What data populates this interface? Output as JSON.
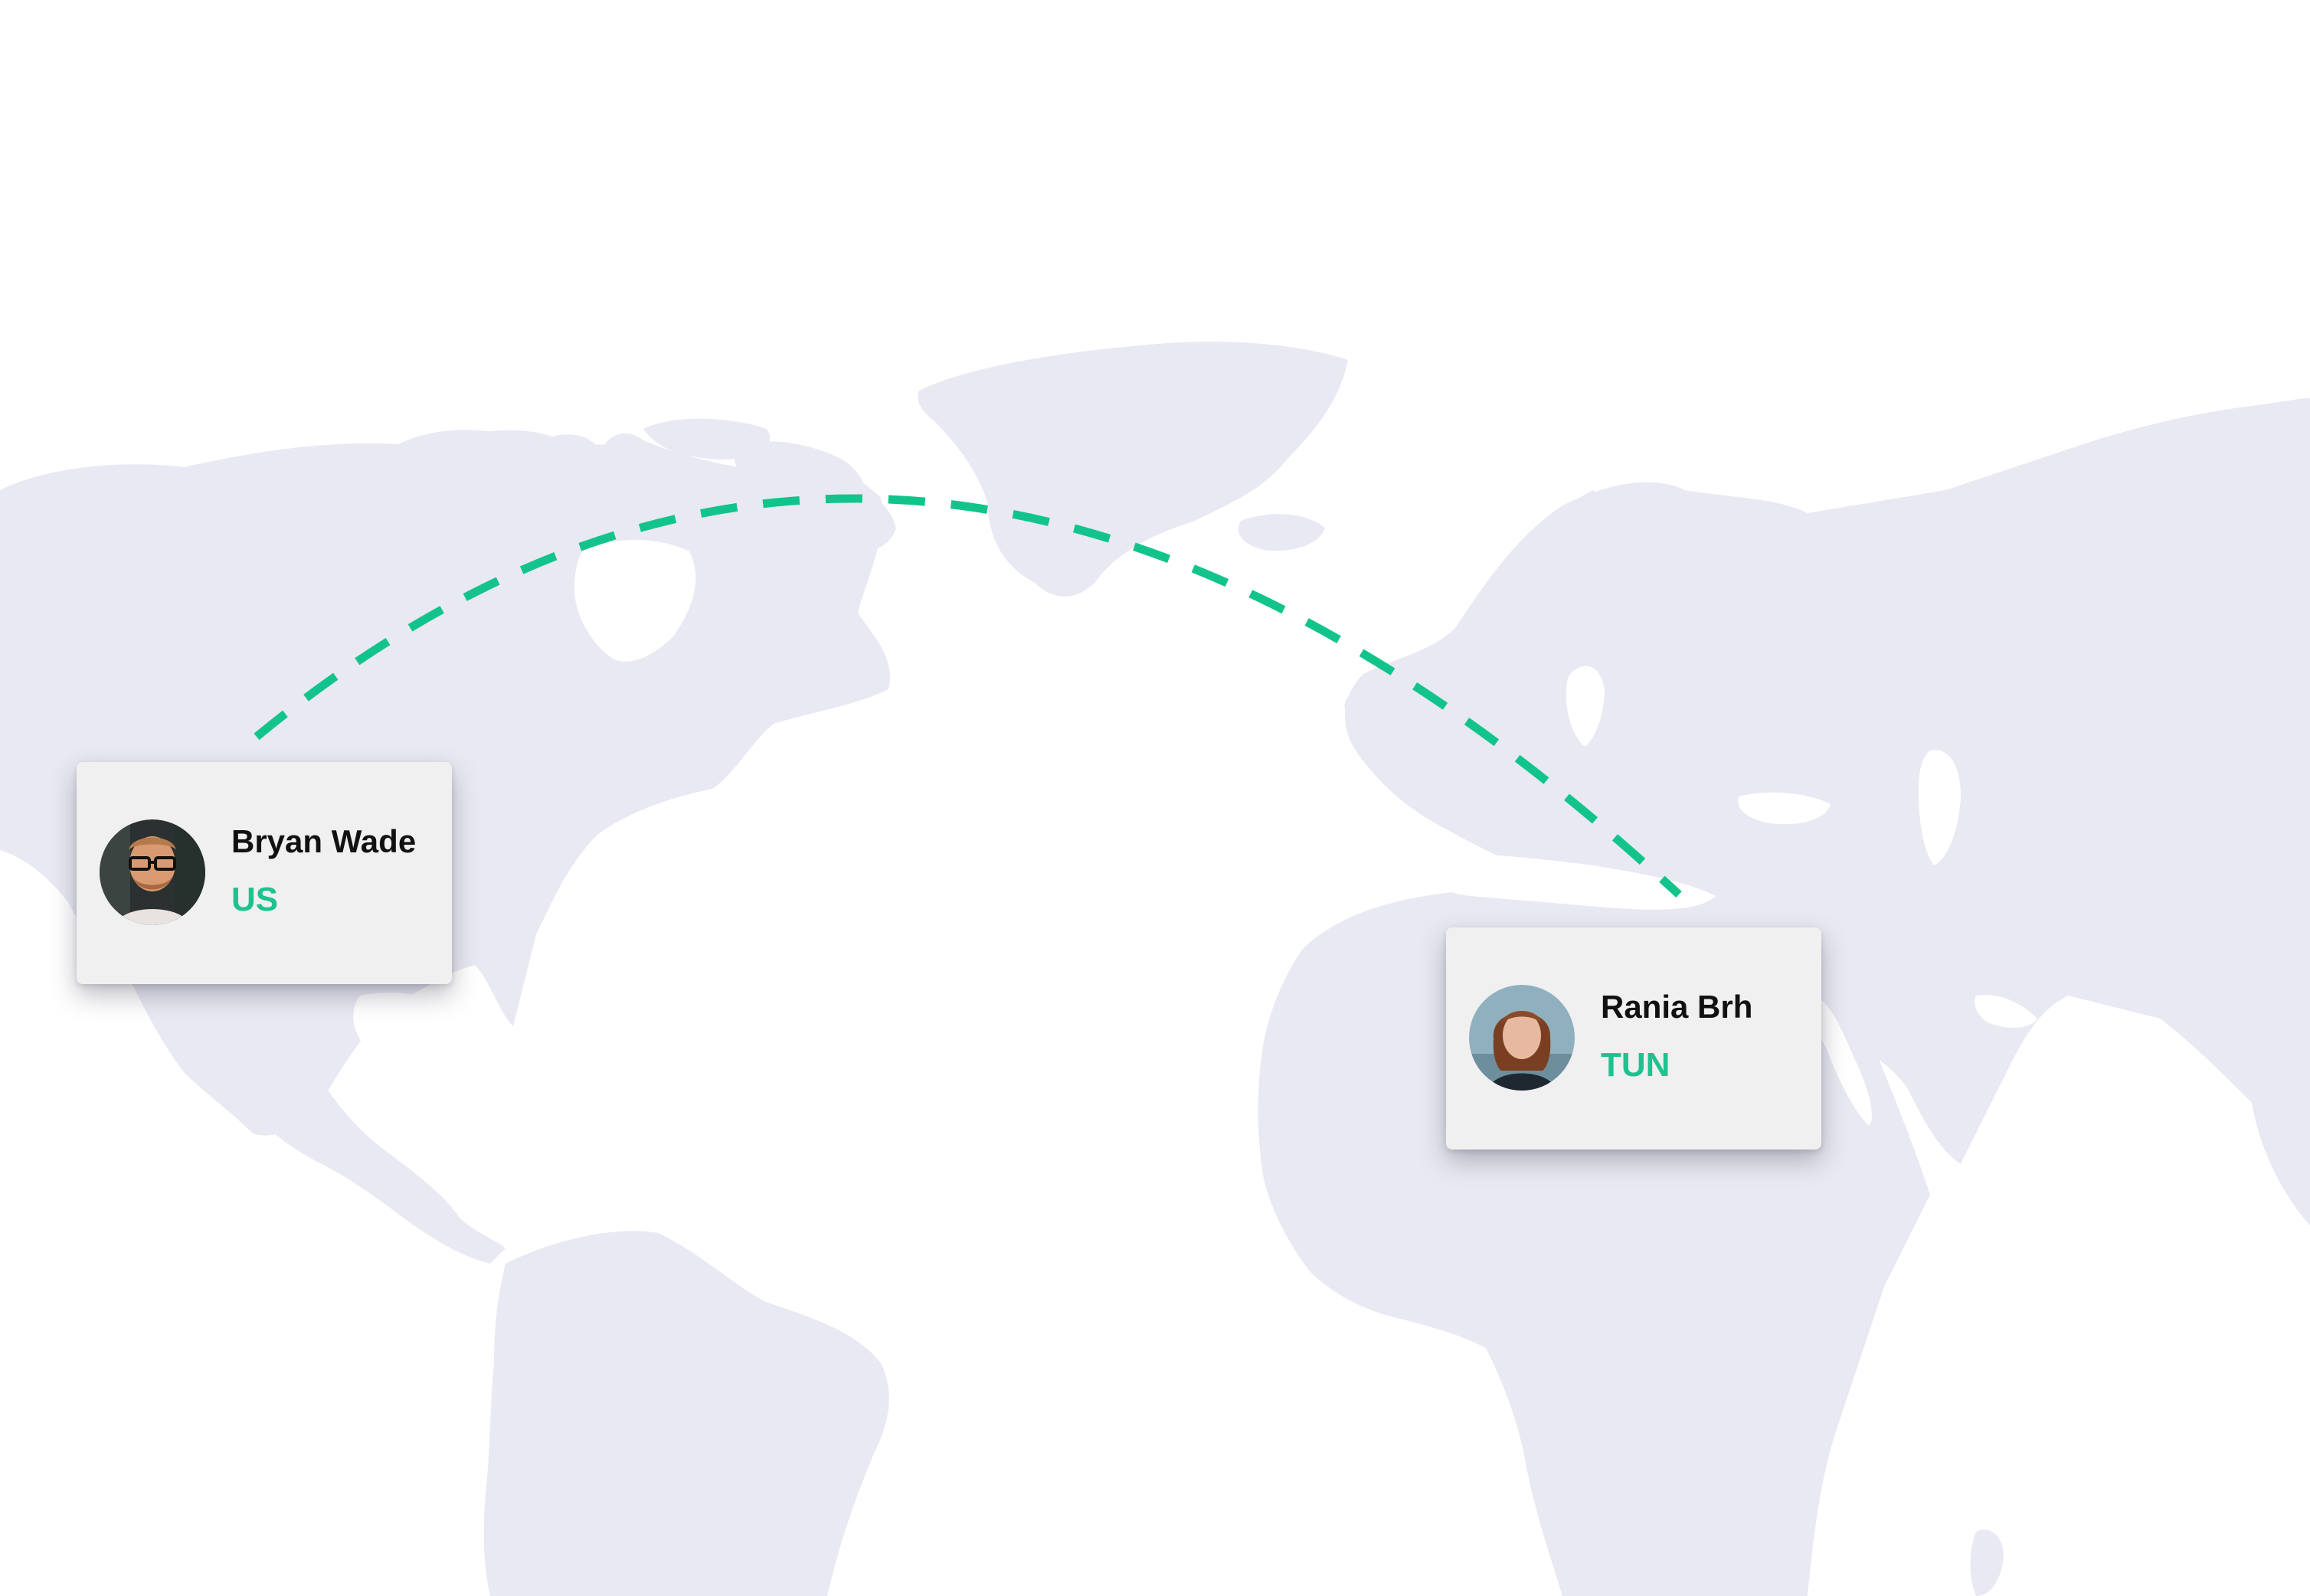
{
  "colors": {
    "land": "#e9e9f3",
    "route": "#12c48b",
    "country_text": "#1dc28f",
    "card_background": "#f0f0f0"
  },
  "users": [
    {
      "name": "Bryan Wade",
      "country": "US",
      "avatar": "man-with-glasses-avatar"
    },
    {
      "name": "Rania Brh",
      "country": "TUN",
      "avatar": "woman-red-hair-avatar"
    }
  ],
  "route": {
    "from": "US",
    "to": "TUN",
    "style": "dashed"
  }
}
